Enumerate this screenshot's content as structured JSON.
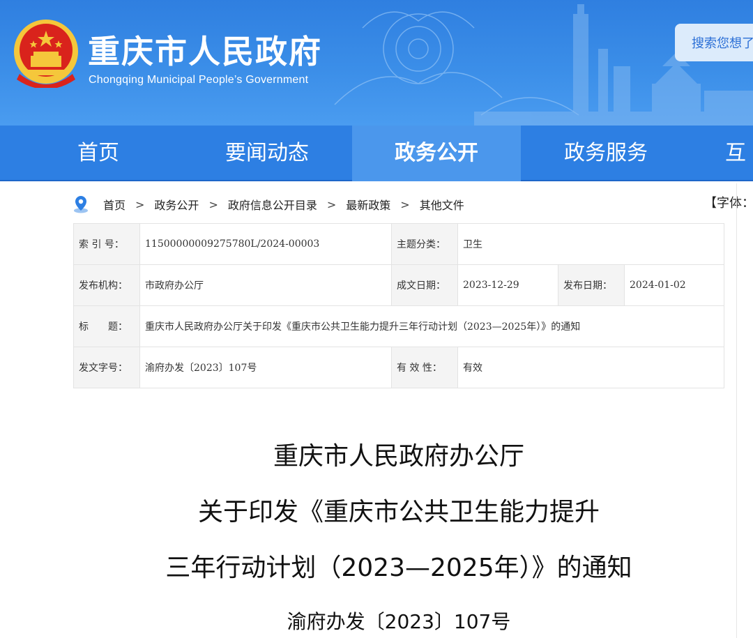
{
  "header": {
    "title": "重庆市人民政府",
    "subtitle": "Chongqing Municipal People’s Government",
    "search_placeholder": "搜索您想了"
  },
  "nav": {
    "items": [
      {
        "label": "首页",
        "active": false
      },
      {
        "label": "要闻动态",
        "active": false
      },
      {
        "label": "政务公开",
        "active": true
      },
      {
        "label": "政务服务",
        "active": false
      },
      {
        "label": "互",
        "active": false
      }
    ]
  },
  "breadcrumb": {
    "items": [
      "首页",
      "政务公开",
      "政府信息公开目录",
      "最新政策",
      "其他文件"
    ],
    "separator": ">"
  },
  "font_size_label": "【字体：",
  "meta": {
    "index_label": "索 引 号：",
    "index_value": "11500000009275780L/2024-00003",
    "topic_label": "主题分类：",
    "topic_value": "卫生",
    "org_label": "发布机构：",
    "org_value": "市政府办公厅",
    "written_label": "成文日期：",
    "written_value": "2023-12-29",
    "pub_label": "发布日期：",
    "pub_value": "2024-01-02",
    "title_label": "标　　题：",
    "title_value": "重庆市人民政府办公厅关于印发《重庆市公共卫生能力提升三年行动计划（2023—2025年）》的通知",
    "docno_label": "发文字号：",
    "docno_value": "渝府办发〔2023〕107号",
    "valid_label": "有 效 性：",
    "valid_value": "有效"
  },
  "article": {
    "line1": "重庆市人民政府办公厅",
    "line2": "关于印发《重庆市公共卫生能力提升",
    "line3": "三年行动计划（2023—2025年）》的通知",
    "doc_no": "渝府办发〔2023〕107号"
  },
  "colors": {
    "banner": "#3b8ee8",
    "nav": "#2d7fe3",
    "nav_active": "#4b97ec",
    "emblem_red": "#d9231c",
    "emblem_gold": "#f5c73b"
  }
}
